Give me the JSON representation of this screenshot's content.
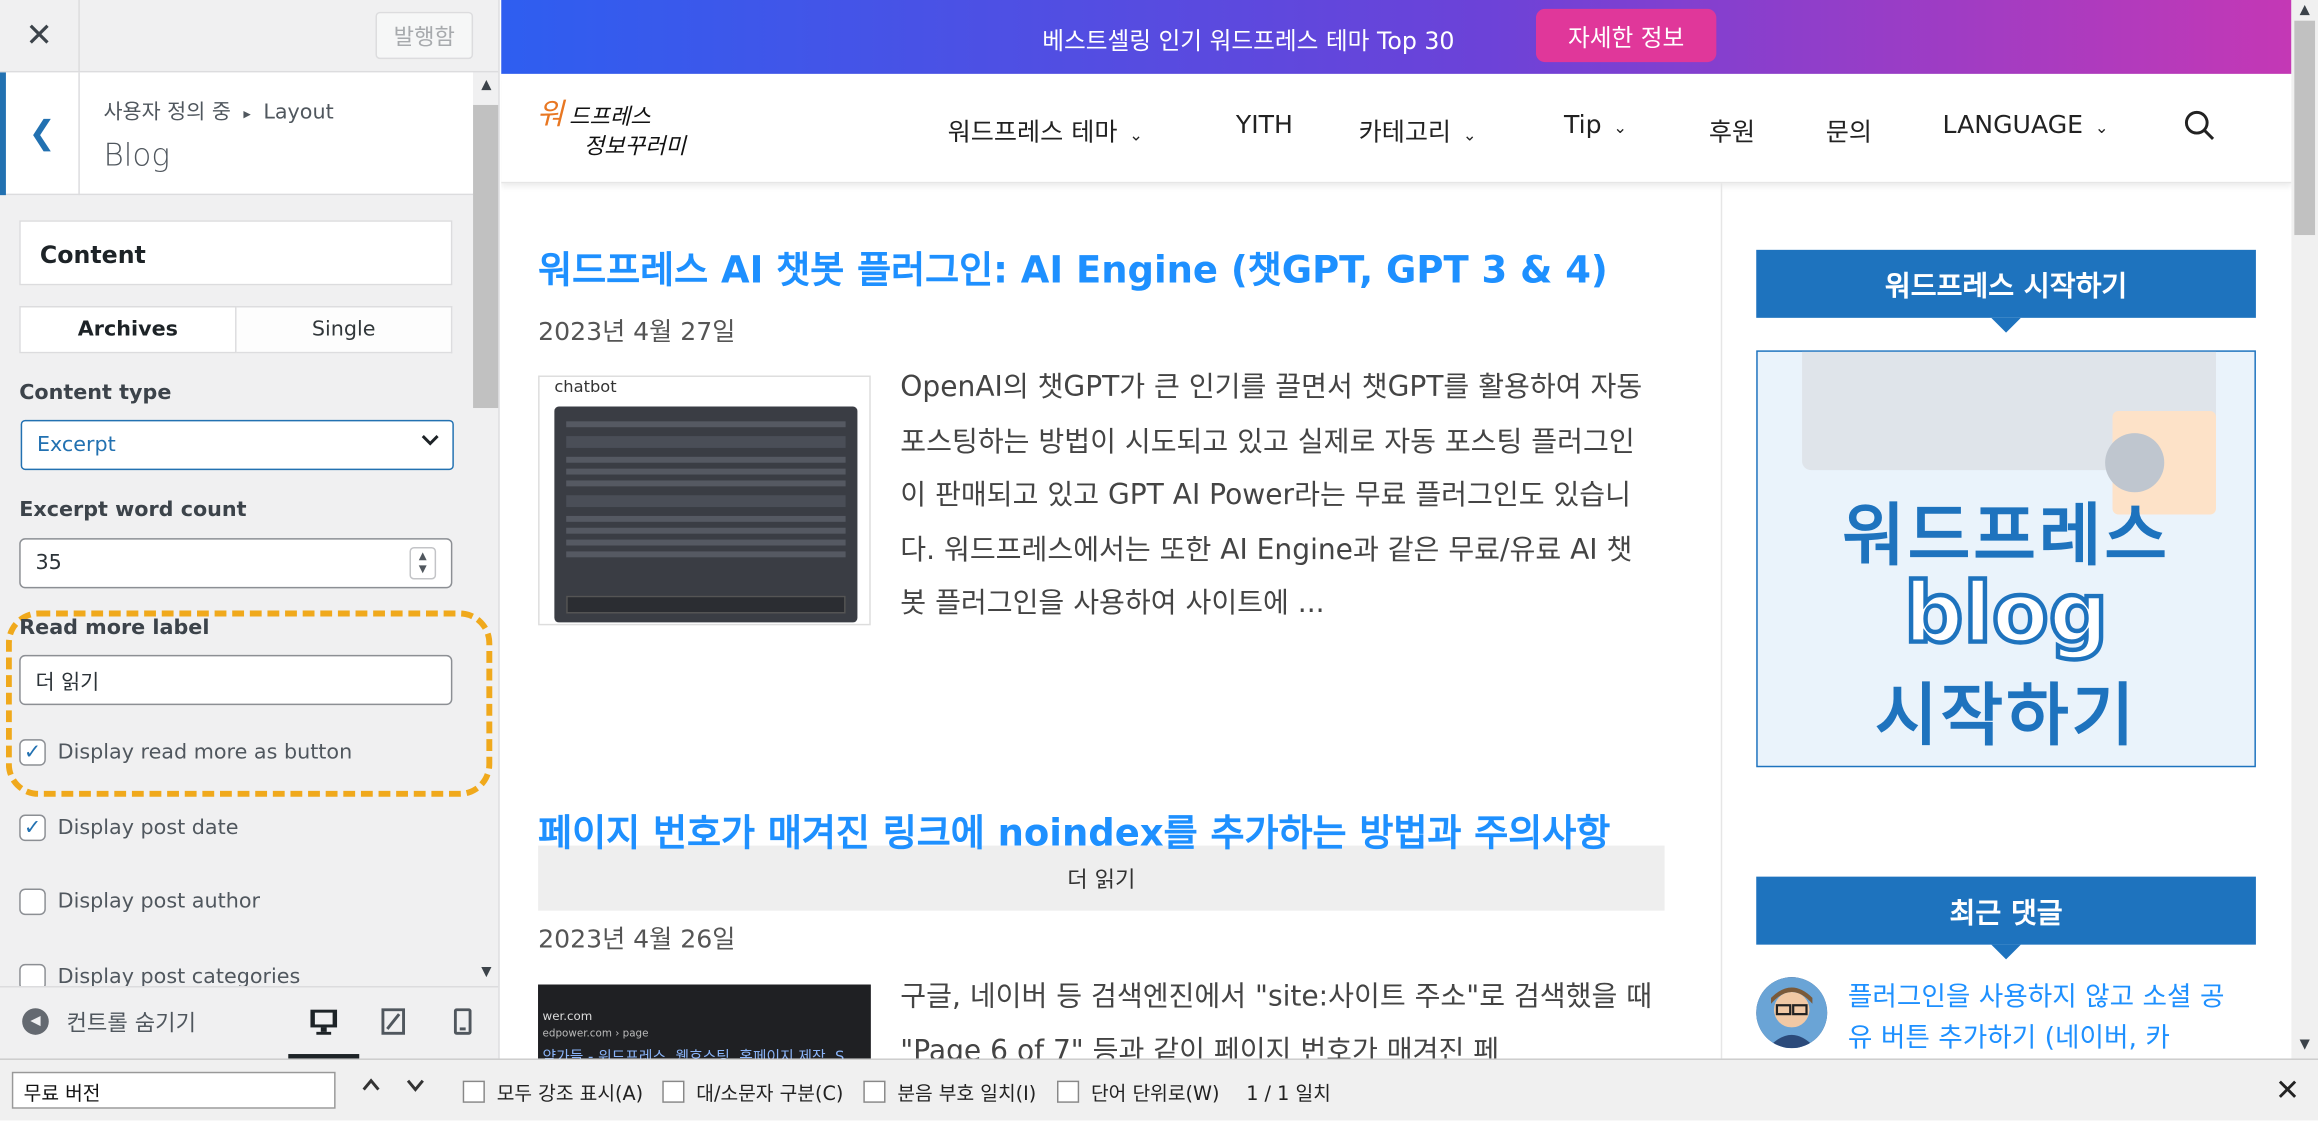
{
  "customizer": {
    "publish_label": "발행함",
    "breadcrumb_parent": "사용자 정의 중",
    "breadcrumb_sep": "▸",
    "breadcrumb_section": "Layout",
    "section_title": "Blog",
    "content_heading": "Content",
    "tabs": [
      {
        "label": "Archives",
        "active": true
      },
      {
        "label": "Single",
        "active": false
      }
    ],
    "content_type": {
      "label": "Content type",
      "value": "Excerpt"
    },
    "excerpt_count": {
      "label": "Excerpt word count",
      "value": "35"
    },
    "read_more": {
      "label": "Read more label",
      "value": "더 읽기"
    },
    "checkboxes": [
      {
        "label": "Display read more as button",
        "checked": true
      },
      {
        "label": "Display post date",
        "checked": true
      },
      {
        "label": "Display post author",
        "checked": false
      },
      {
        "label": "Display post categories",
        "checked": false
      }
    ],
    "hide_controls_label": "컨트롤 숨기기",
    "highlight_color": "#f0a91c"
  },
  "site": {
    "banner": {
      "text": "베스트셀링 인기 워드프레스 테마 Top 30",
      "button": "자세한 정보"
    },
    "nav": [
      {
        "label": "워드프레스 테마",
        "dropdown": true
      },
      {
        "label": "YITH",
        "dropdown": false
      },
      {
        "label": "카테고리",
        "dropdown": true
      },
      {
        "label": "Tip",
        "dropdown": true
      },
      {
        "label": "후원",
        "dropdown": false
      },
      {
        "label": "문의",
        "dropdown": false
      },
      {
        "label": "LANGUAGE",
        "dropdown": true
      }
    ],
    "posts": [
      {
        "title": "워드프레스 AI 챗봇 플러그인: AI Engine (챗GPT, GPT 3 & 4)",
        "date": "2023년 4월 27일",
        "thumb_caption": "chatbot",
        "excerpt": "OpenAI의 챗GPT가 큰 인기를 끌면서 챗GPT를 활용하여 자동 포스팅하는 방법이 시도되고 있고 실제로 자동 포스팅 플러그인이 판매되고 있고 GPT AI Power라는 무료 플러그인도 있습니다. 워드프레스에서는 또한 AI Engine과 같은 무료/유료 AI 챗봇 플러그인을 사용하여 사이트에 ...",
        "read_more": "더 읽기"
      },
      {
        "title": "페이지 번호가 매겨진 링크에 noindex를 추가하는 방법과 주의사항",
        "date": "2023년 4월 26일",
        "thumb_lines": [
          "wer.com",
          "edpower.com › page",
          "약가들 - 워드프레스, 웹호스팅, 홈페이지 제작, S"
        ],
        "excerpt": "구글, 네이버 등 검색엔진에서 \"site:사이트 주소\"로 검색했을 때 \"Page 6 of 7\" 등과 같이 페이지 번호가 매겨진 페"
      }
    ],
    "sidebar": {
      "widget1_title": "워드프레스 시작하기",
      "ad_lines": [
        "워드프레스",
        "blog",
        "시작하기"
      ],
      "widget2_title": "최근 댓글",
      "comment_link": "플러그인을 사용하지 않고 소셜 공유 버튼 추가하기 (네이버, 카"
    }
  },
  "findbar": {
    "query": "무료 버전",
    "options": [
      "모두 강조 표시(A)",
      "대/소문자 구분(C)",
      "분음 부호 일치(I)",
      "단어 단위로(W)"
    ],
    "count": "1 / 1 일치"
  },
  "colors": {
    "link": "#1e90ff",
    "widget": "#1e73be",
    "wp_blue": "#2271b1"
  }
}
